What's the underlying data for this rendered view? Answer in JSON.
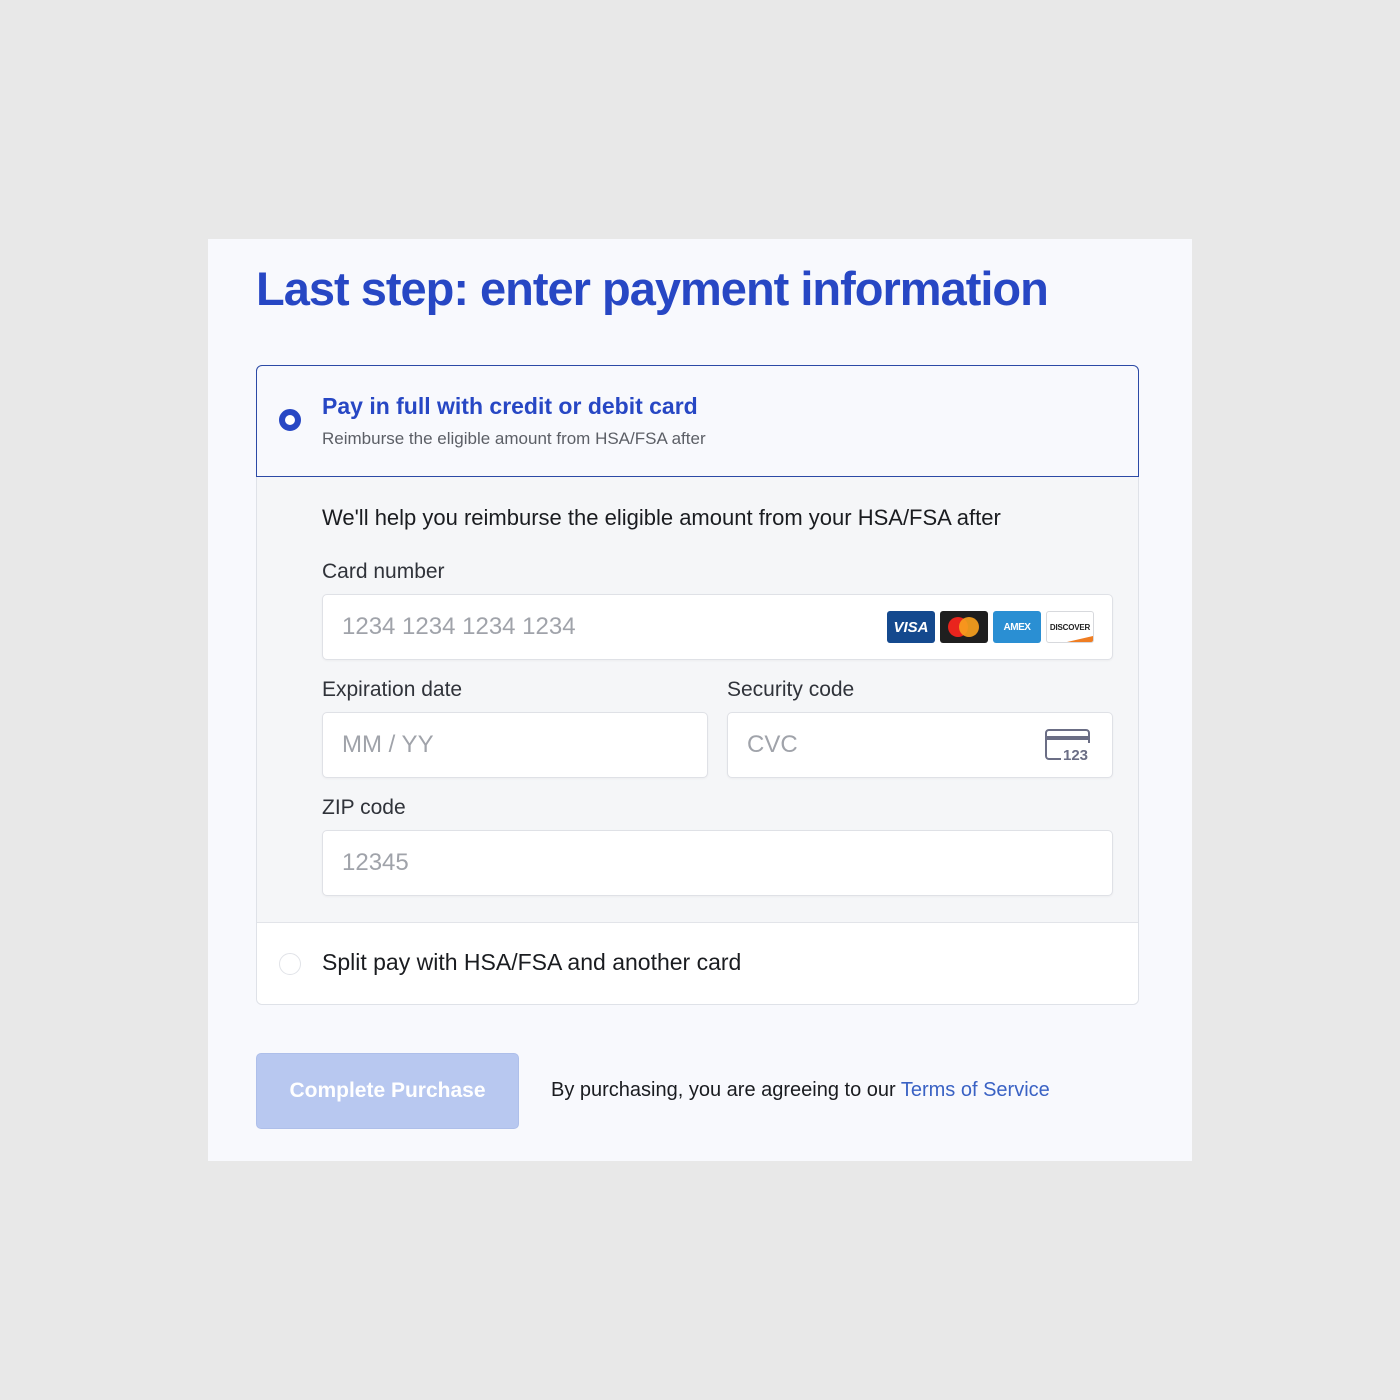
{
  "page": {
    "title": "Last step: enter payment information"
  },
  "payment_options": {
    "full": {
      "title": "Pay in full with credit or debit card",
      "subtitle": "Reimburse the eligible amount from HSA/FSA after",
      "selected": true
    },
    "split": {
      "label": "Split pay with HSA/FSA and another card",
      "selected": false
    }
  },
  "card_form": {
    "help_text": "We'll help you reimburse the eligible amount from your HSA/FSA after",
    "card_number": {
      "label": "Card number",
      "placeholder": "1234 1234 1234 1234",
      "value": ""
    },
    "expiration": {
      "label": "Expiration date",
      "placeholder": "MM / YY",
      "value": ""
    },
    "security_code": {
      "label": "Security code",
      "placeholder": "CVC",
      "value": "",
      "icon_text": "123"
    },
    "zip": {
      "label": "ZIP code",
      "placeholder": "12345",
      "value": ""
    },
    "brands": {
      "visa": "VISA",
      "amex": "AMEX",
      "discover": "DISCOVER"
    }
  },
  "footer": {
    "button_label": "Complete Purchase",
    "agreement_text": "By purchasing, you are agreeing to our ",
    "terms_link": "Terms of Service"
  },
  "colors": {
    "accent": "#2747c4",
    "button_disabled": "#b8c8f0",
    "link": "#3a62c4"
  },
  "icons": [
    "radio-selected-icon",
    "visa-icon",
    "mastercard-icon",
    "amex-icon",
    "discover-icon",
    "cvc-card-icon",
    "radio-unselected-icon"
  ]
}
